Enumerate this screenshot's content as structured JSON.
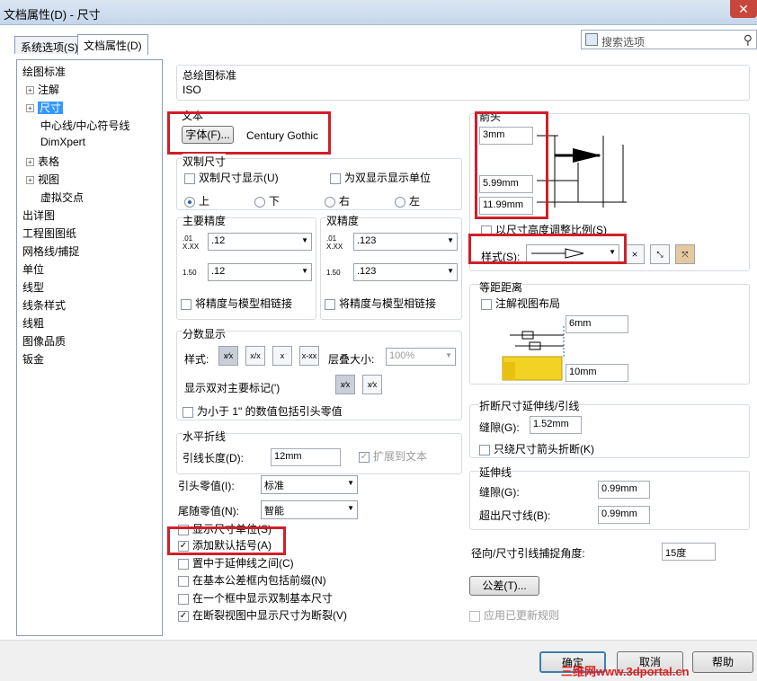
{
  "window": {
    "title": "文档属性(D) - 尺寸",
    "close": "✕"
  },
  "tabs": [
    {
      "label": "系统选项(S)"
    },
    {
      "label": "文档属性(D)"
    }
  ],
  "search": {
    "placeholder": "搜索选项"
  },
  "tree": [
    {
      "label": "绘图标准"
    },
    {
      "label": "注解"
    },
    {
      "label": "尺寸"
    },
    {
      "label": "中心线/中心符号线"
    },
    {
      "label": "DimXpert"
    },
    {
      "label": "表格"
    },
    {
      "label": "视图"
    },
    {
      "label": "虚拟交点"
    },
    {
      "label": "出详图"
    },
    {
      "label": "工程图图纸"
    },
    {
      "label": "网格线/捕捉"
    },
    {
      "label": "单位"
    },
    {
      "label": "线型"
    },
    {
      "label": "线条样式"
    },
    {
      "label": "线粗"
    },
    {
      "label": "图像品质"
    },
    {
      "label": "钣金"
    }
  ],
  "overall_standard": {
    "title": "总绘图标准",
    "value": "ISO"
  },
  "text": {
    "title": "文本",
    "font_button": "字体(F)...",
    "font_name": "Century Gothic"
  },
  "dual": {
    "title": "双制尺寸",
    "dual_display": "双制尺寸显示(U)",
    "dual_units": "为双显示显示单位",
    "radios": [
      "上",
      "下",
      "右",
      "左"
    ]
  },
  "primary_precision": {
    "title": "主要精度",
    "value1": ".12",
    "value2": ".12",
    "link": "将精度与模型相链接"
  },
  "dual_precision": {
    "title": "双精度",
    "value1": ".123",
    "value2": ".123",
    "link": "将精度与模型相链接"
  },
  "fraction": {
    "title": "分数显示",
    "style_label": "样式:",
    "stack_label": "层叠大小:",
    "stack_value": "100%",
    "dual_mark": "显示双对主要标记(')",
    "include_zero": "为小于 1\" 的数值包括引头零值"
  },
  "bent": {
    "title": "水平折线",
    "leader_label": "引线长度(D):",
    "leader_value": "12mm",
    "extend": "扩展到文本"
  },
  "leading_zero": {
    "label": "引头零值(I):",
    "value": "标准"
  },
  "trailing_zero": {
    "label": "尾随零值(N):",
    "value": "智能"
  },
  "checks": [
    "显示尺寸单位(S)",
    "添加默认括号(A)",
    "置中于延伸线之间(C)",
    "在基本公差框内包括前缀(N)",
    "在一个框中显示双制基本尺寸",
    "在断裂视图中显示尺寸为断裂(V)"
  ],
  "arrows": {
    "title": "箭头",
    "v1": "3mm",
    "v2": "5.99mm",
    "v3": "11.99mm",
    "scale": "以尺寸高度调整比例(S)",
    "style_label": "样式(S):"
  },
  "offset": {
    "title": "等距距离",
    "layout": "注解视图布局",
    "v1": "6mm",
    "v2": "10mm"
  },
  "break_ext": {
    "title": "折断尺寸延伸线/引线",
    "gap_label": "缝隙(G):",
    "gap_value": "1.52mm",
    "arrow_only": "只绕尺寸箭头折断(K)"
  },
  "extension": {
    "title": "延伸线",
    "gap_label": "缝隙(G):",
    "gap_value": "0.99mm",
    "beyond_label": "超出尺寸线(B):",
    "beyond_value": "0.99mm"
  },
  "snap": {
    "label": "径向/尺寸引线捕捉角度:",
    "value": "15度"
  },
  "tolerance_button": "公差(T)...",
  "apply_updated": "应用已更新规则",
  "footer": {
    "ok": "确定",
    "cancel": "取消",
    "help": "帮助",
    "watermark": "三维网www.3dportal.cn"
  },
  "precision_icons": {
    "p1": ".01 X.XX",
    "p2": "1.50"
  },
  "fraction_styles": [
    "x⁄x",
    "x/x",
    "x",
    "x-xx"
  ]
}
